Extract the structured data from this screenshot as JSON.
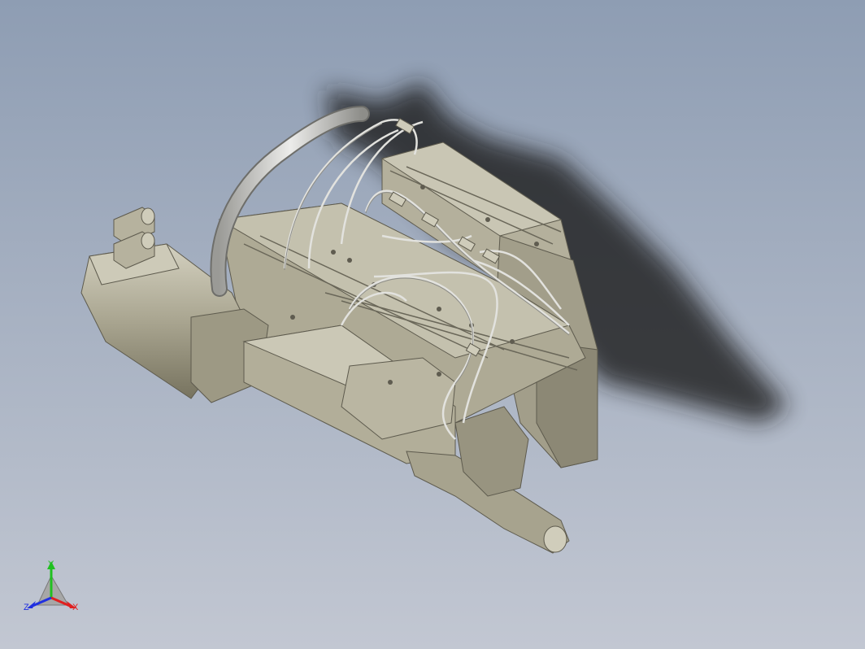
{
  "viewport": {
    "background_top": "#8e9db3",
    "background_bottom": "#c2c7d2",
    "shadow_color": "#1a1a1a"
  },
  "model": {
    "body_color": "#a9a590",
    "body_light": "#c9c6b4",
    "body_dark": "#6f6c5e",
    "hose_color": "#d3d3cf",
    "cable_color": "#dcdcd8"
  },
  "triad": {
    "y_label": "Y",
    "x_label": "X",
    "z_label": "Z",
    "y_color": "#20c020",
    "x_color": "#e02020",
    "z_color": "#2030e0"
  }
}
